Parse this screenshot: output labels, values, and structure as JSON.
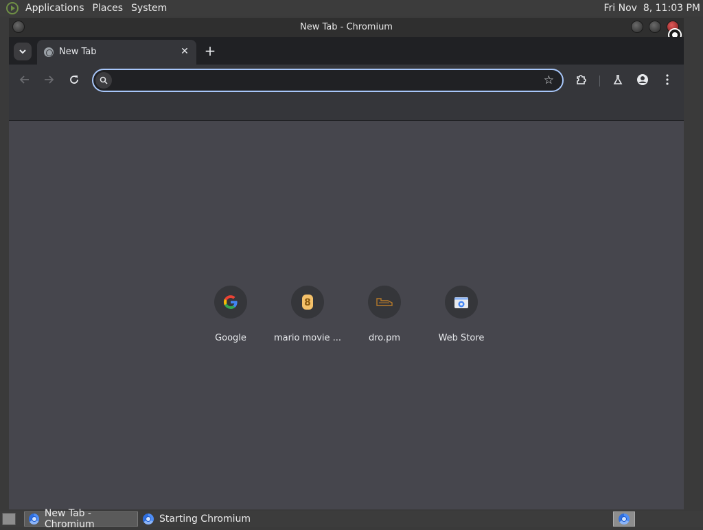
{
  "top_panel": {
    "menus": [
      "Applications",
      "Places",
      "System"
    ],
    "clock": "Fri Nov  8, 11:03 PM"
  },
  "window": {
    "title": "New Tab - Chromium"
  },
  "tabs": [
    {
      "label": "New Tab",
      "active": true
    }
  ],
  "toolbar": {
    "omnibox_value": "",
    "icons": [
      "back-icon",
      "forward-icon",
      "reload-icon",
      "search-icon",
      "star-icon",
      "extensions-icon",
      "labs-icon",
      "profile-icon",
      "menu-icon"
    ]
  },
  "shortcuts": [
    {
      "name": "Google",
      "icon": "google-icon"
    },
    {
      "name": "mario movie ...",
      "icon": "mario-movie-icon"
    },
    {
      "name": "dro.pm",
      "icon": "dro-pm-icon"
    },
    {
      "name": "Web Store",
      "icon": "web-store-icon"
    }
  ],
  "taskbar": {
    "tasks": [
      {
        "label": "New Tab - Chromium",
        "active": true
      },
      {
        "label": "Starting Chromium",
        "active": false
      }
    ]
  },
  "colors": {
    "omnibox_focus": "#a8c7fa",
    "content_bg": "#46464d",
    "toolbar_bg": "#35363a"
  }
}
